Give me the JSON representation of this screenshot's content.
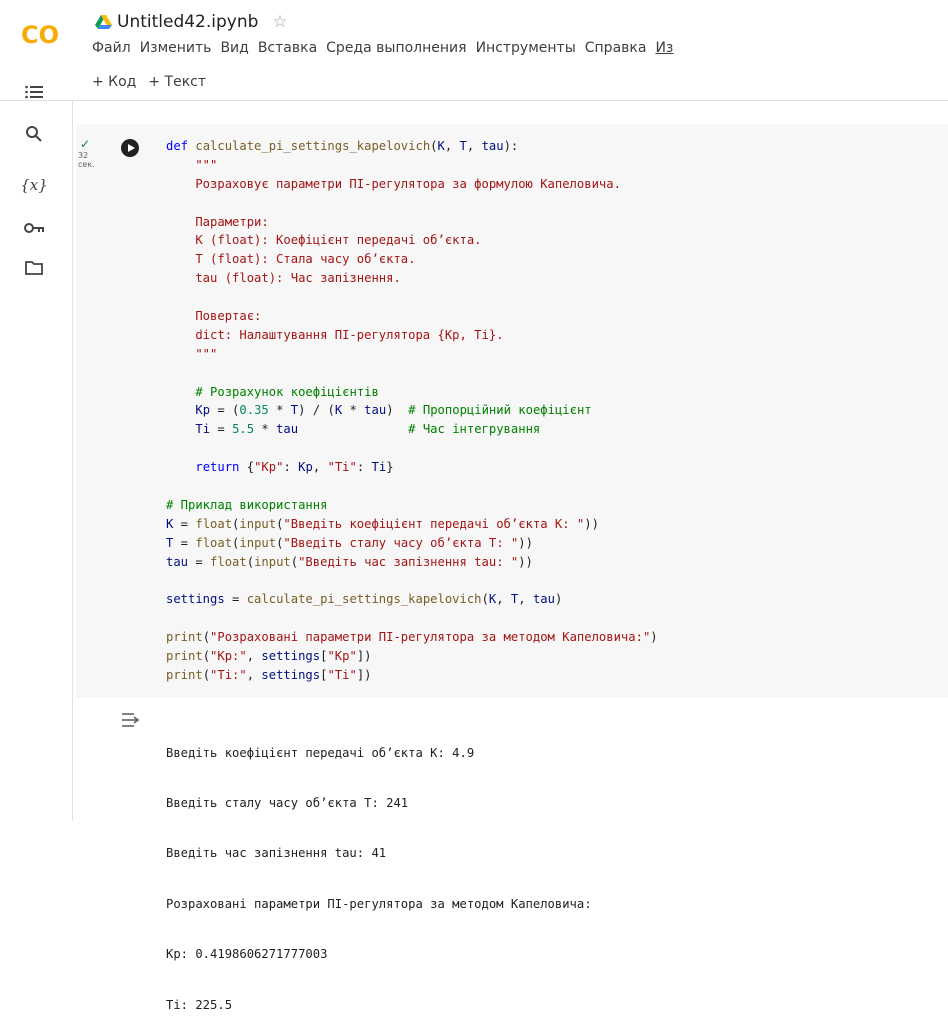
{
  "app": {
    "logo_text": "CO",
    "notebook_title": "Untitled42.ipynb"
  },
  "menu": [
    "Файл",
    "Изменить",
    "Вид",
    "Вставка",
    "Среда выполнения",
    "Инструменты",
    "Справка",
    "Из"
  ],
  "toolbar": {
    "add_code": "+ Код",
    "add_text": "+ Текст"
  },
  "sidebar": {
    "icons": [
      "table-of-contents-icon",
      "search-icon",
      "variables-icon",
      "secrets-key-icon",
      "files-folder-icon"
    ],
    "variables_label": "{x}"
  },
  "cell": {
    "exec_status": "✓",
    "exec_seconds": "32",
    "exec_unit": "сек.",
    "code_lines": [
      "def calculate_pi_settings_kapelovich(K, T, tau):",
      "    \"\"\"",
      "    Розраховує параметри ПІ-регулятора за формулою Капеловича.",
      "",
      "    Параметри:",
      "    K (float): Коефіцієнт передачі об’єкта.",
      "    T (float): Стала часу об’єкта.",
      "    tau (float): Час запізнення.",
      "",
      "    Повертає:",
      "    dict: Налаштування ПІ-регулятора {Kp, Ti}.",
      "    \"\"\"",
      "",
      "    # Розрахунок коефіцієнтів",
      "    Kp = (0.35 * T) / (K * tau)  # Пропорційний коефіцієнт",
      "    Ti = 5.5 * tau               # Час інтегрування",
      "",
      "    return {\"Kp\": Kp, \"Ti\": Ti}",
      "",
      "# Приклад використання",
      "K = float(input(\"Введіть коефіцієнт передачі об’єкта K: \"))",
      "T = float(input(\"Введіть сталу часу об’єкта T: \"))",
      "tau = float(input(\"Введіть час запізнення tau: \"))",
      "",
      "settings = calculate_pi_settings_kapelovich(K, T, tau)",
      "",
      "print(\"Розраховані параметри ПІ-регулятора за методом Капеловича:\")",
      "print(\"Kp:\", settings[\"Kp\"])",
      "print(\"Ti:\", settings[\"Ti\"])"
    ]
  },
  "output": {
    "lines": [
      "Введіть коефіцієнт передачі об’єкта K: 4.9",
      "Введіть сталу часу об’єкта T: 241",
      "Введіть час запізнення tau: 41",
      "Розраховані параметри ПІ-регулятора за методом Капеловича:",
      "Kp: 0.4198606271777003",
      "Ti: 225.5"
    ]
  }
}
